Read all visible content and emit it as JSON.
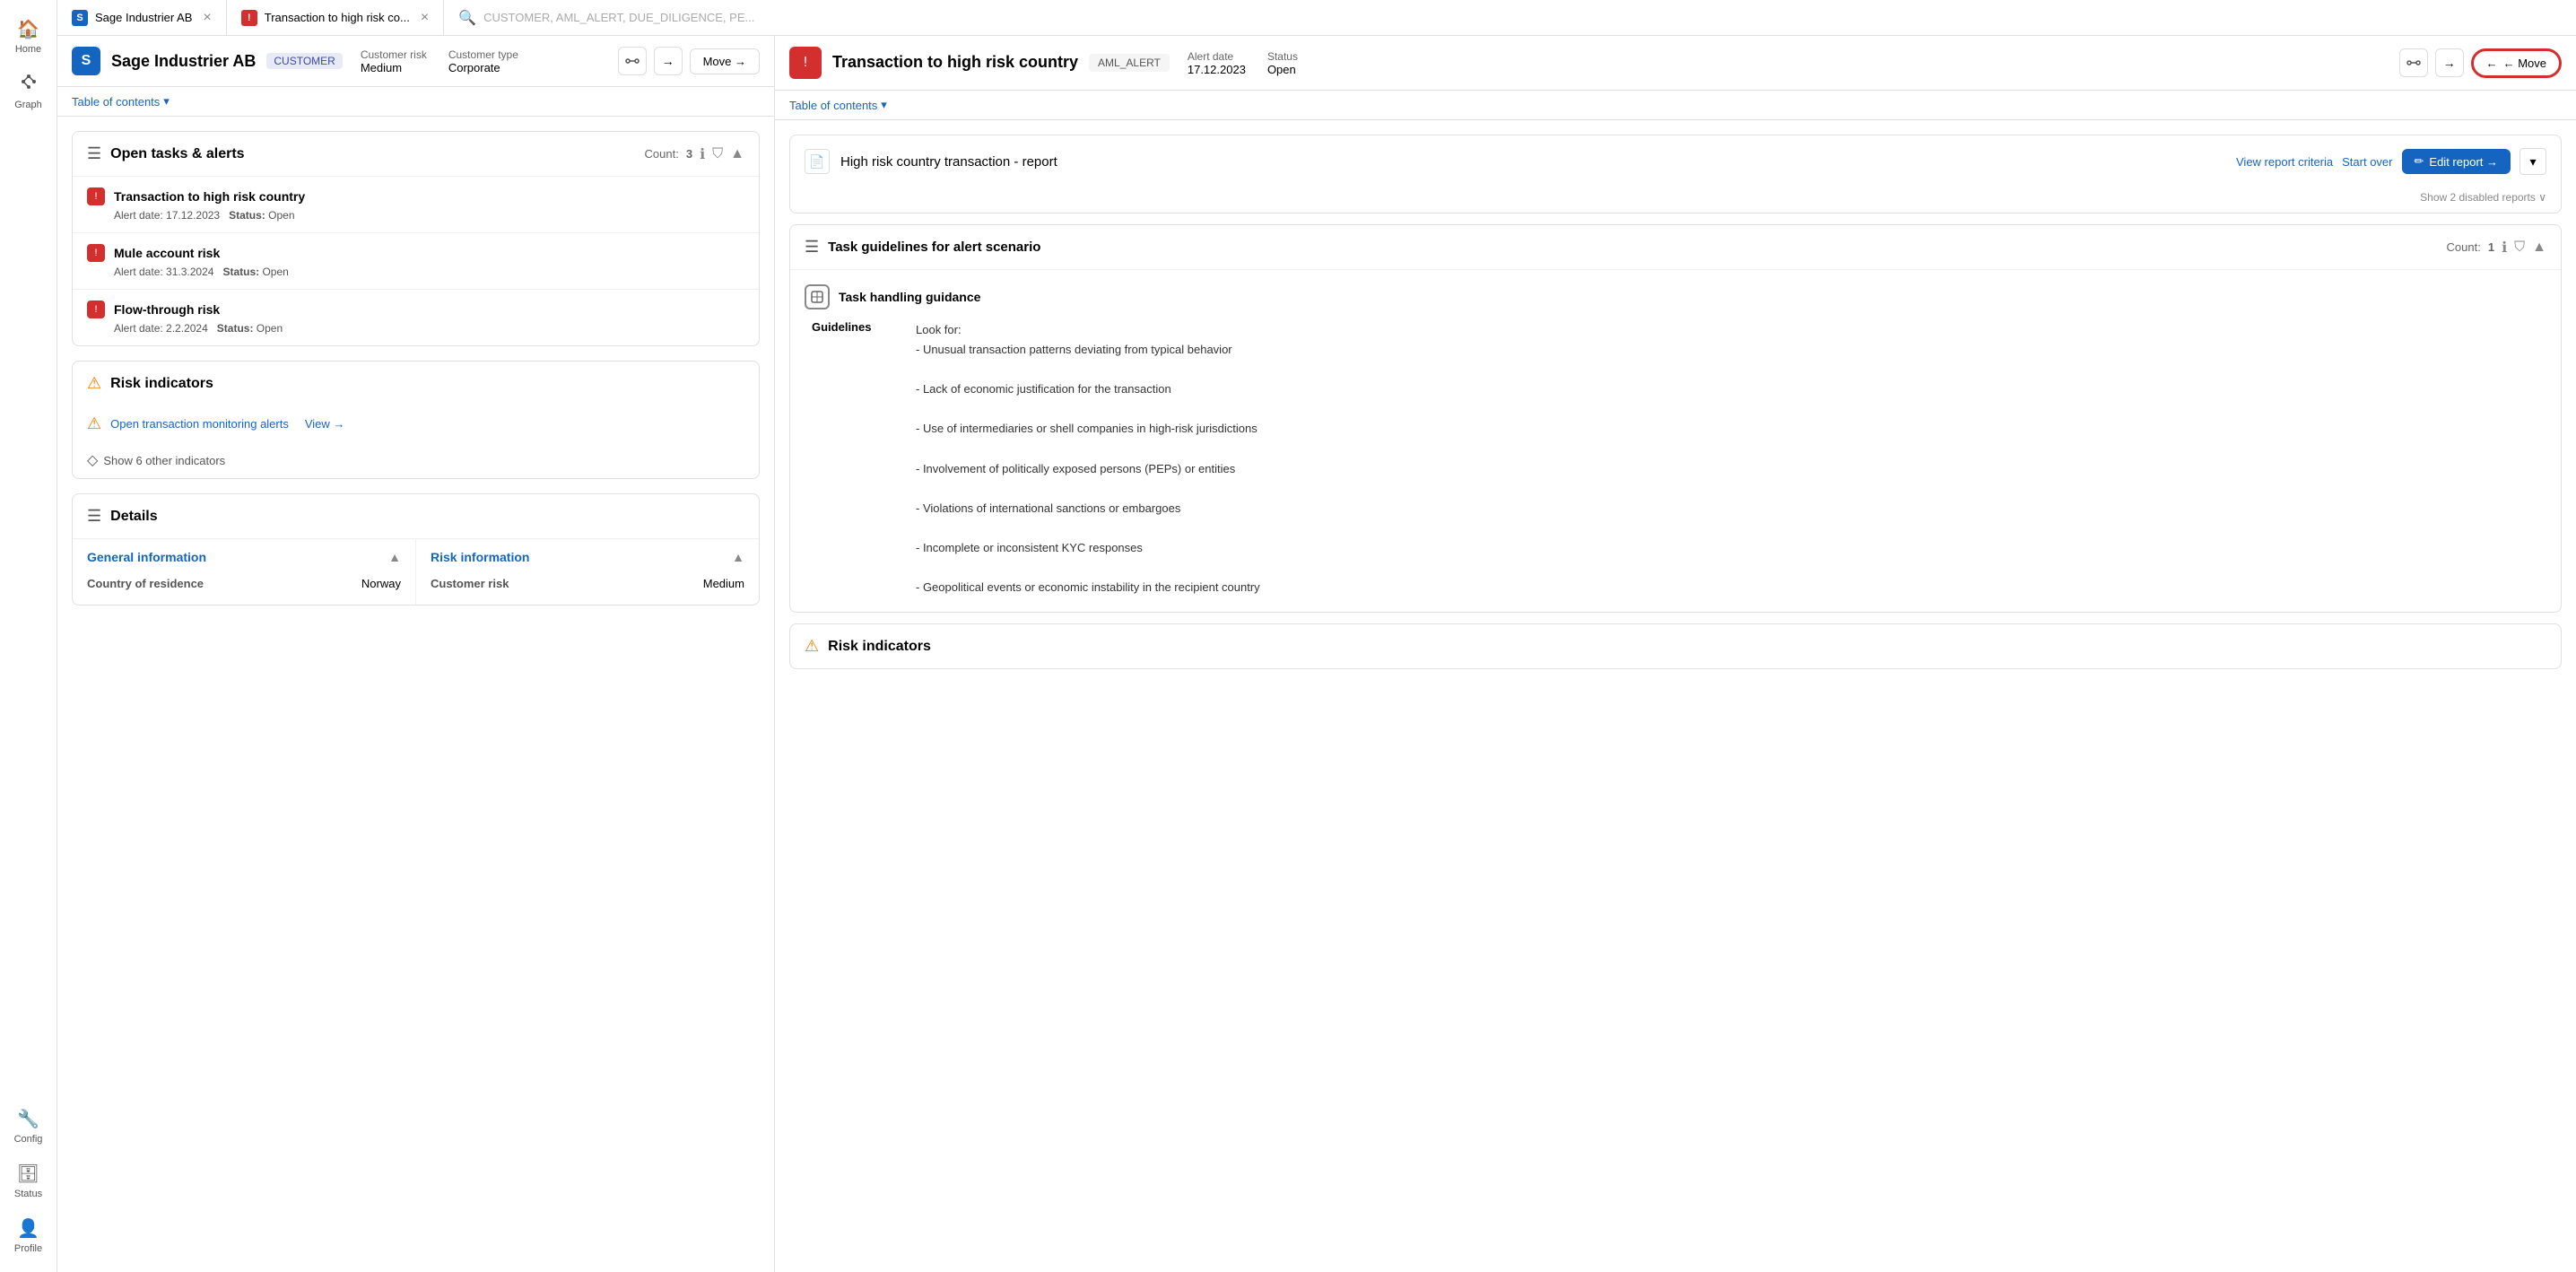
{
  "sidebar": {
    "items": [
      {
        "label": "Home",
        "icon": "🏠"
      },
      {
        "label": "Graph",
        "icon": "⎋"
      },
      {
        "label": "Config",
        "icon": "🔧"
      },
      {
        "label": "Status",
        "icon": "🗄"
      },
      {
        "label": "Profile",
        "icon": "👤"
      }
    ]
  },
  "tabs": [
    {
      "id": "tab1",
      "label": "Sage Industrier AB",
      "iconColor": "blue",
      "iconText": "S",
      "closable": true
    },
    {
      "id": "tab2",
      "label": "Transaction to high risk co...",
      "iconColor": "red",
      "iconText": "!",
      "closable": true
    }
  ],
  "search": {
    "placeholder": "CUSTOMER, AML_ALERT, DUE_DILIGENCE, PE..."
  },
  "left_panel": {
    "entity_icon": "S",
    "title": "Sage Industrier AB",
    "badge": "CUSTOMER",
    "customer_risk_label": "Customer risk",
    "customer_risk_value": "Medium",
    "customer_type_label": "Customer type",
    "customer_type_value": "Corporate",
    "toc_label": "Table of contents",
    "move_label": "Move →",
    "sections": {
      "open_tasks": {
        "title": "Open tasks & alerts",
        "count_label": "Count:",
        "count": "3",
        "alerts": [
          {
            "title": "Transaction to high risk country",
            "alert_date_label": "Alert date:",
            "alert_date": "17.12.2023",
            "status_label": "Status:",
            "status": "Open"
          },
          {
            "title": "Mule account risk",
            "alert_date_label": "Alert date:",
            "alert_date": "31.3.2024",
            "status_label": "Status:",
            "status": "Open"
          },
          {
            "title": "Flow-through risk",
            "alert_date_label": "Alert date:",
            "alert_date": "2.2.2024",
            "status_label": "Status:",
            "status": "Open"
          }
        ]
      },
      "risk_indicators": {
        "title": "Risk indicators",
        "monitoring_label": "Open transaction monitoring alerts",
        "view_label": "View →",
        "show_more_label": "Show 6 other indicators"
      },
      "details": {
        "title": "Details",
        "general_info": {
          "title": "General information",
          "rows": [
            {
              "label": "Country of residence",
              "value": "Norway"
            }
          ]
        },
        "risk_info": {
          "title": "Risk information",
          "rows": [
            {
              "label": "Customer risk",
              "value": "Medium"
            }
          ]
        }
      }
    }
  },
  "right_panel": {
    "title": "Transaction to high risk country",
    "badge": "AML_ALERT",
    "alert_date_label": "Alert date",
    "alert_date": "17.12.2023",
    "status_label": "Status",
    "status": "Open",
    "toc_label": "Table of contents",
    "move_back_label": "← Move",
    "report": {
      "title": "High risk country transaction - report",
      "view_criteria_label": "View report criteria",
      "start_over_label": "Start over",
      "edit_report_label": "Edit report →",
      "disabled_reports_label": "Show 2 disabled reports ∨"
    },
    "task_guidelines": {
      "title": "Task guidelines for alert scenario",
      "count_label": "Count:",
      "count": "1",
      "guidance": {
        "title": "Task handling guidance",
        "guidelines_label": "Guidelines",
        "guidelines_text": "Look for:\n- Unusual transaction patterns deviating from typical behavior\n\n- Lack of economic justification for the transaction\n\n- Use of intermediaries or shell companies in high-risk jurisdictions\n\n- Involvement of politically exposed persons (PEPs) or entities\n\n- Violations of international sanctions or embargoes\n\n- Incomplete or inconsistent KYC responses\n\n- Geopolitical events or economic instability in the recipient country"
      }
    },
    "risk_indicators": {
      "title": "Risk indicators"
    }
  }
}
